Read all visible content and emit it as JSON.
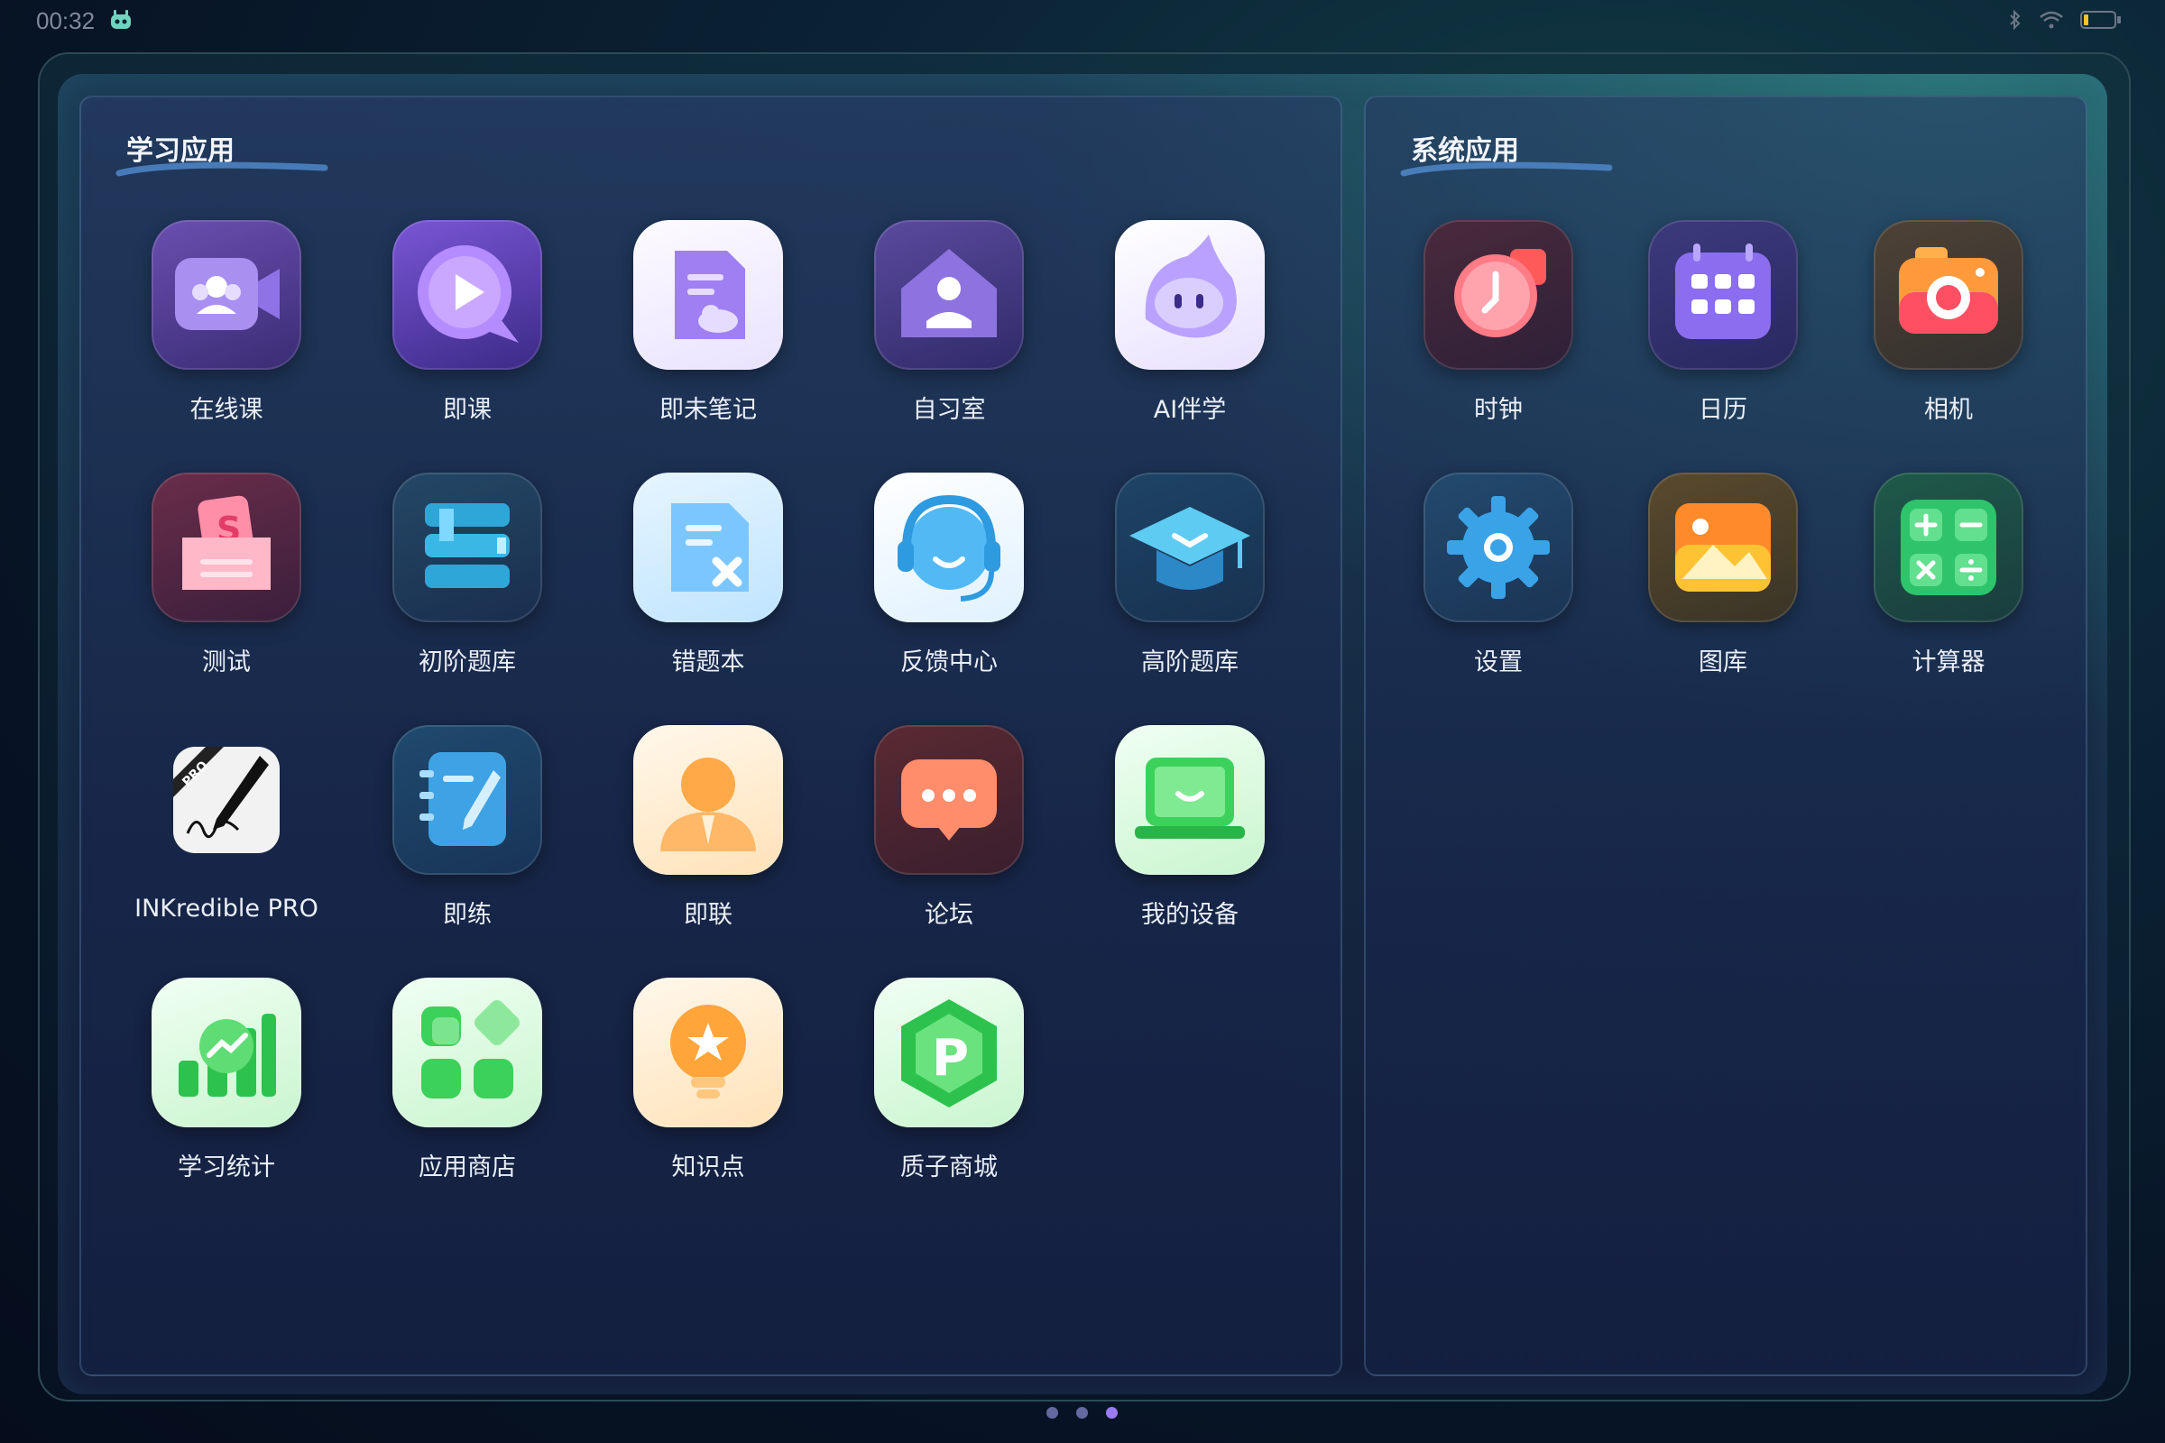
{
  "status_bar": {
    "time": "00:32"
  },
  "sections": {
    "study_title": "学习应用",
    "system_title": "系统应用"
  },
  "study_apps": [
    {
      "label": "在线课",
      "icon": "video-group-icon"
    },
    {
      "label": "即课",
      "icon": "play-bubble-icon"
    },
    {
      "label": "即未笔记",
      "icon": "note-cloud-icon"
    },
    {
      "label": "自习室",
      "icon": "house-study-icon"
    },
    {
      "label": "AI伴学",
      "icon": "ai-mascot-icon"
    },
    {
      "label": "测试",
      "icon": "test-envelope-icon"
    },
    {
      "label": "初阶题库",
      "icon": "books-stack-icon"
    },
    {
      "label": "错题本",
      "icon": "wrong-notebook-icon"
    },
    {
      "label": "反馈中心",
      "icon": "headset-icon"
    },
    {
      "label": "高阶题库",
      "icon": "graduation-cap-icon"
    },
    {
      "label": "INKredible PRO",
      "icon": "pen-signature-icon"
    },
    {
      "label": "即练",
      "icon": "notebook-pen-icon"
    },
    {
      "label": "即联",
      "icon": "person-bust-icon"
    },
    {
      "label": "论坛",
      "icon": "chat-bubble-icon"
    },
    {
      "label": "我的设备",
      "icon": "laptop-smile-icon"
    },
    {
      "label": "学习统计",
      "icon": "chart-trend-icon"
    },
    {
      "label": "应用商店",
      "icon": "app-grid-icon"
    },
    {
      "label": "知识点",
      "icon": "lightbulb-star-icon"
    },
    {
      "label": "质子商城",
      "icon": "hexagon-p-icon"
    }
  ],
  "system_apps": [
    {
      "label": "时钟",
      "icon": "clock-icon"
    },
    {
      "label": "日历",
      "icon": "calendar-icon"
    },
    {
      "label": "相机",
      "icon": "camera-icon"
    },
    {
      "label": "设置",
      "icon": "gear-icon"
    },
    {
      "label": "图库",
      "icon": "gallery-icon"
    },
    {
      "label": "计算器",
      "icon": "calculator-icon"
    }
  ],
  "pager": {
    "pages": 3,
    "current": 3
  }
}
